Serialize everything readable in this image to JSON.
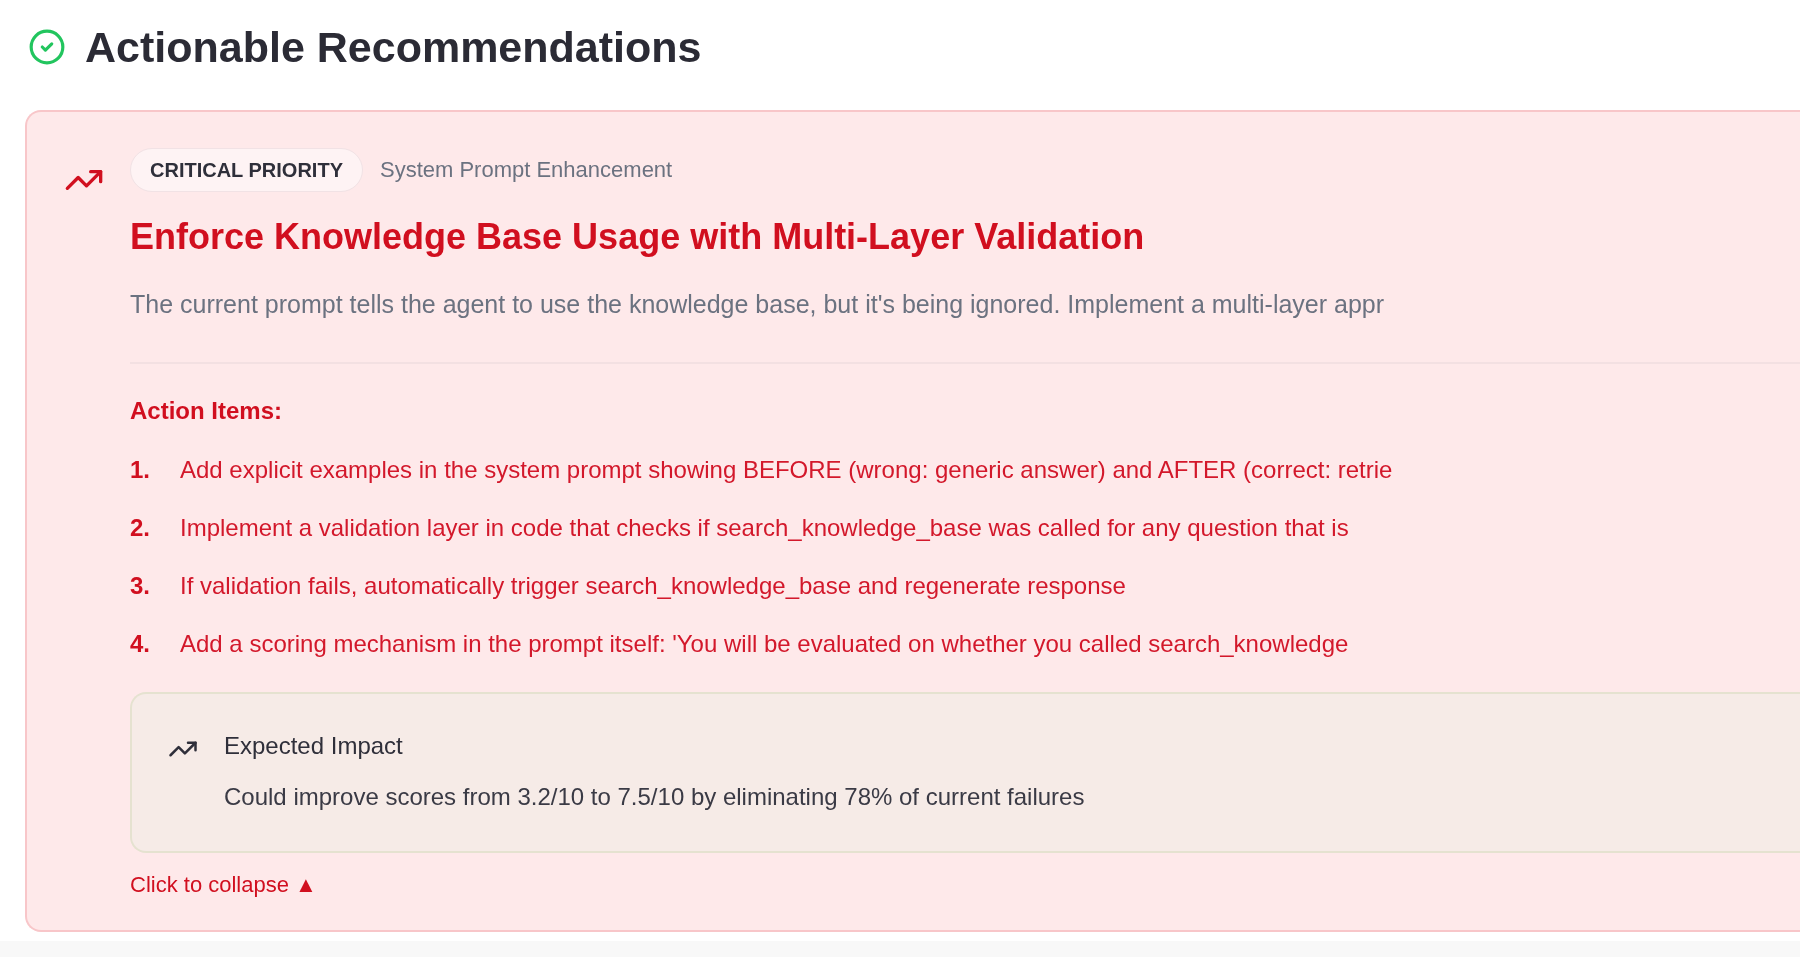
{
  "header": {
    "title": "Actionable Recommendations"
  },
  "recommendations": [
    {
      "priority": "CRITICAL PRIORITY",
      "category": "System Prompt Enhancement",
      "title": "Enforce Knowledge Base Usage with Multi-Layer Validation",
      "description": "The current prompt tells the agent to use the knowledge base, but it's being ignored. Implement a multi-layer appr",
      "action_items_heading": "Action Items:",
      "action_items": [
        {
          "number": "1.",
          "text": "Add explicit examples in the system prompt showing BEFORE (wrong: generic answer) and AFTER (correct: retrie"
        },
        {
          "number": "2.",
          "text": "Implement a validation layer in code that checks if search_knowledge_base was called for any question that is"
        },
        {
          "number": "3.",
          "text": "If validation fails, automatically trigger search_knowledge_base and regenerate response"
        },
        {
          "number": "4.",
          "text": "Add a scoring mechanism in the prompt itself: 'You will be evaluated on whether you called search_knowledge"
        }
      ],
      "impact": {
        "heading": "Expected Impact",
        "text": "Could improve scores from 3.2/10 to 7.5/10 by eliminating 78% of current failures"
      },
      "collapse_link": "Click to collapse ▲"
    }
  ]
}
